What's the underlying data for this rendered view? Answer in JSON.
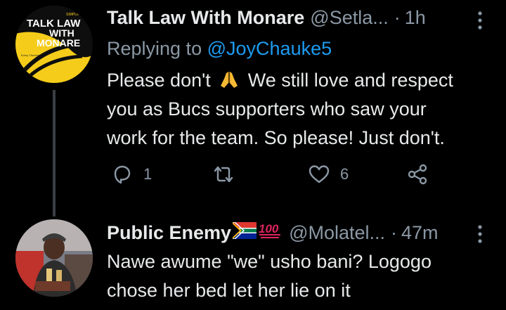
{
  "tweets": [
    {
      "name": "Talk Law With Monare",
      "handle": "@Setla...",
      "separator": "·",
      "time": "1h",
      "replying_prefix": "Replying to",
      "replying_to": "@JoyChauke5",
      "text_line1_a": "Please don't",
      "emoji_icon": "folded-hands-icon",
      "text_line1_b": "We still love and respect",
      "text_line2": "you as Bucs supporters who saw your",
      "text_line3": "work for the team. So please! Just don't.",
      "avatar": {
        "top_small": "SIMPLIFY",
        "line1": "TALK LAW",
        "line2": "WITH",
        "line3": "MONARE",
        "tagline": "Every Thursday"
      },
      "actions": {
        "reply_count": "1",
        "retweet_count": "",
        "like_count": "6"
      }
    },
    {
      "name": "Public Enemy",
      "name_emojis": [
        "south-africa-flag-icon",
        "hundred-points-icon"
      ],
      "handle": "@Molatel...",
      "separator": "·",
      "time": "47m",
      "text_line1": "Nawe awume \"we\" usho bani? Logogo",
      "text_line2": "chose her bed let her lie on it"
    }
  ],
  "colors": {
    "background": "#000000",
    "text": "#e7e9ea",
    "muted": "#8b98a5",
    "link": "#1d9bf0",
    "avatar_yellow": "#f5cc1a"
  }
}
